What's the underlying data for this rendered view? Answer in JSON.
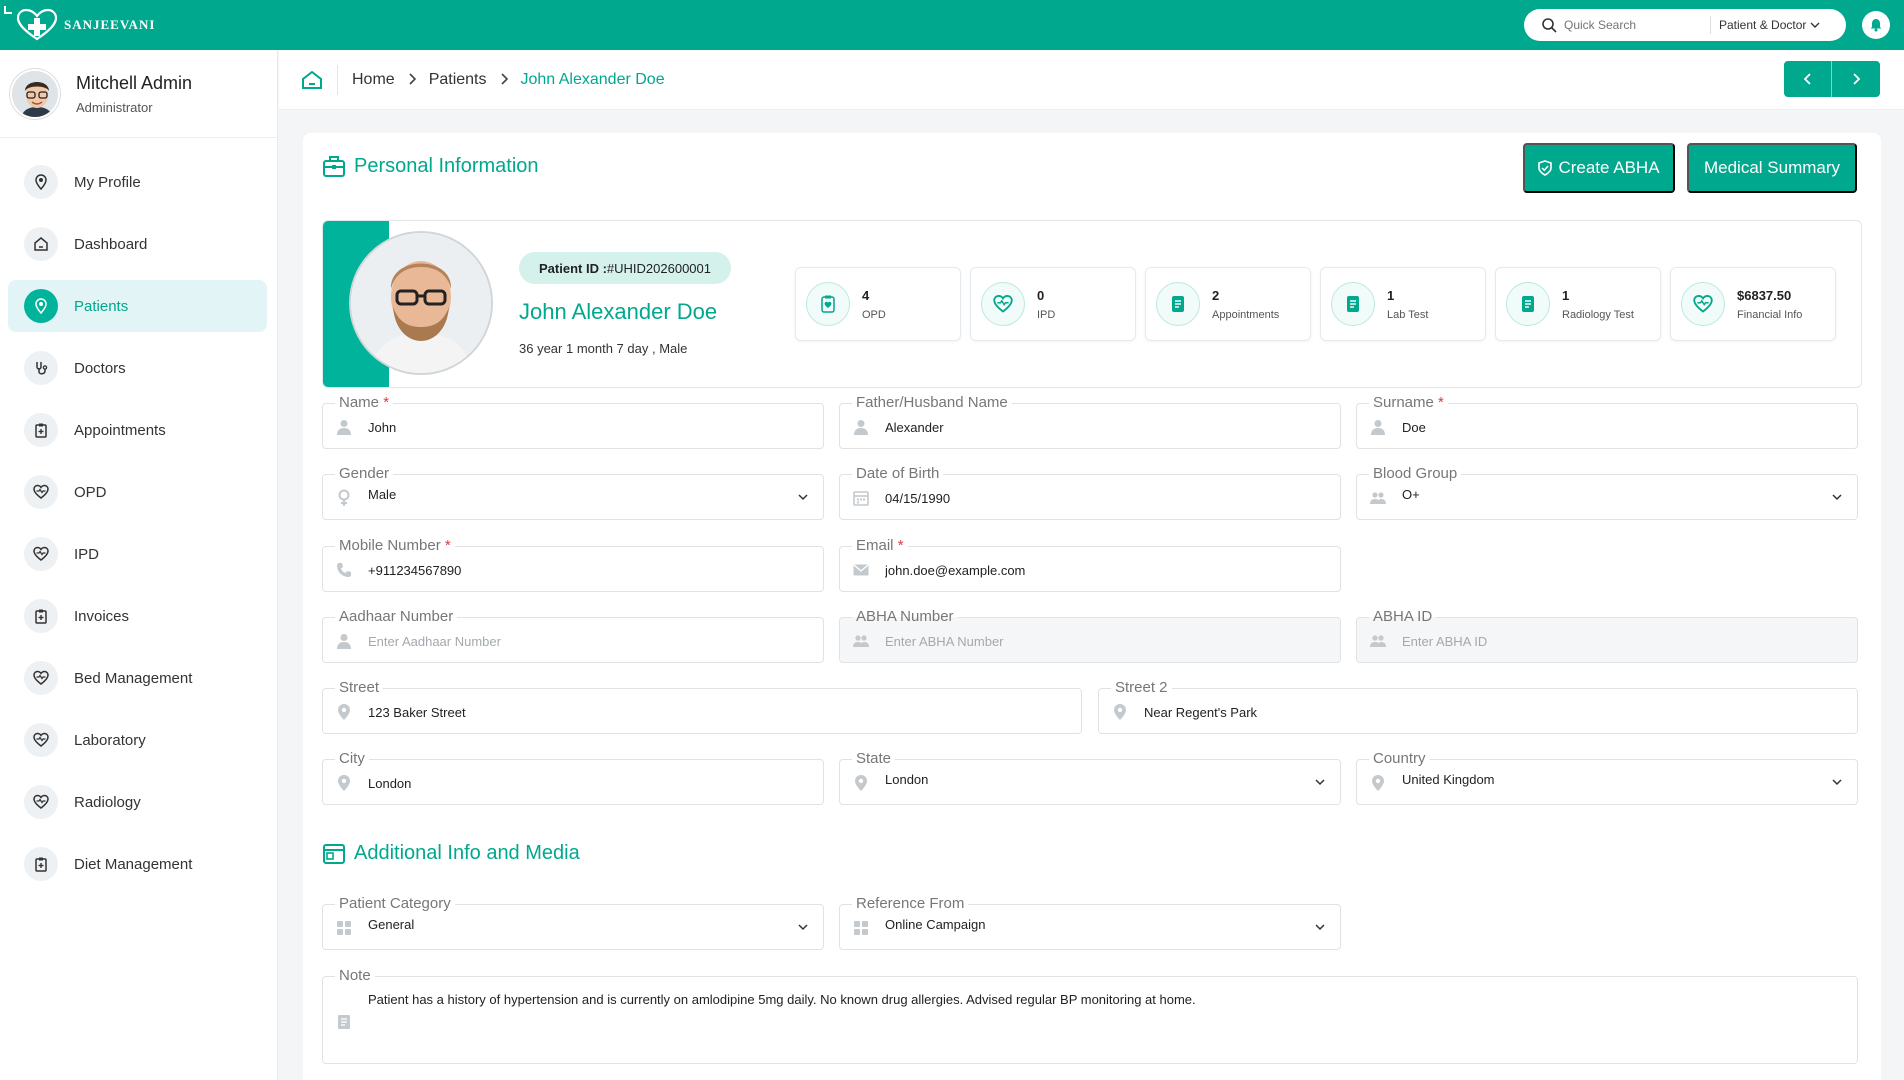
{
  "app": {
    "brand": "SANJEEVANI"
  },
  "topbar": {
    "search_placeholder": "Quick Search",
    "filter_label": "Patient & Doctor"
  },
  "user": {
    "name": "Mitchell Admin",
    "role": "Administrator"
  },
  "nav": [
    {
      "label": "My Profile",
      "icon": "profile-icon"
    },
    {
      "label": "Dashboard",
      "icon": "home-icon"
    },
    {
      "label": "Patients",
      "icon": "patients-icon",
      "active": true
    },
    {
      "label": "Doctors",
      "icon": "stethoscope-icon"
    },
    {
      "label": "Appointments",
      "icon": "clipboard-icon"
    },
    {
      "label": "OPD",
      "icon": "heart-pulse-icon"
    },
    {
      "label": "IPD",
      "icon": "heart-pulse-icon"
    },
    {
      "label": "Invoices",
      "icon": "clipboard-icon"
    },
    {
      "label": "Bed Management",
      "icon": "heart-pulse-icon"
    },
    {
      "label": "Laboratory",
      "icon": "heart-pulse-icon"
    },
    {
      "label": "Radiology",
      "icon": "heart-pulse-icon"
    },
    {
      "label": "Diet Management",
      "icon": "clipboard-icon"
    }
  ],
  "breadcrumb": {
    "home": "Home",
    "patients": "Patients",
    "current": "John Alexander Doe"
  },
  "sections": {
    "personal": "Personal Information",
    "additional": "Additional Info and Media"
  },
  "actions": {
    "create_abha": "Create ABHA",
    "medical_summary": "Medical Summary"
  },
  "patient": {
    "id_label": "Patient ID : ",
    "id": "#UHID202600001",
    "name": "John Alexander Doe",
    "meta": "36 year 1 month 7 day , Male"
  },
  "stats": [
    {
      "value": "4",
      "label": "OPD"
    },
    {
      "value": "0",
      "label": "IPD"
    },
    {
      "value": "2",
      "label": "Appointments"
    },
    {
      "value": "1",
      "label": "Lab Test"
    },
    {
      "value": "1",
      "label": "Radiology Test"
    },
    {
      "value": "$6837.50",
      "label": "Financial Info"
    }
  ],
  "form": {
    "name": {
      "label": "Name",
      "value": "John"
    },
    "father": {
      "label": "Father/Husband Name",
      "value": "Alexander"
    },
    "surname": {
      "label": "Surname",
      "value": "Doe"
    },
    "gender": {
      "label": "Gender",
      "value": "Male"
    },
    "dob": {
      "label": "Date of Birth",
      "value": "04/15/1990"
    },
    "blood": {
      "label": "Blood Group",
      "value": "O+"
    },
    "mobile": {
      "label": "Mobile Number",
      "value": "+911234567890"
    },
    "email": {
      "label": "Email",
      "value": "john.doe@example.com"
    },
    "aadhaar": {
      "label": "Aadhaar Number",
      "placeholder": "Enter Aadhaar Number"
    },
    "abha_number": {
      "label": "ABHA Number",
      "placeholder": "Enter ABHA Number"
    },
    "abha_id": {
      "label": "ABHA ID",
      "placeholder": "Enter ABHA ID"
    },
    "street": {
      "label": "Street",
      "value": "123 Baker Street"
    },
    "street2": {
      "label": "Street 2",
      "value": "Near Regent's Park"
    },
    "city": {
      "label": "City",
      "value": "London"
    },
    "state": {
      "label": "State",
      "value": "London"
    },
    "country": {
      "label": "Country",
      "value": "United Kingdom"
    },
    "category": {
      "label": "Patient Category",
      "value": "General"
    },
    "reference": {
      "label": "Reference From",
      "value": "Online Campaign"
    },
    "note": {
      "label": "Note",
      "value": "Patient has a history of hypertension and is currently on amlodipine 5mg daily. No known drug allergies. Advised regular BP monitoring at home."
    }
  },
  "colors": {
    "primary": "#00a88e",
    "active_bg": "#e3f4f7",
    "required": "#e03a3a"
  }
}
